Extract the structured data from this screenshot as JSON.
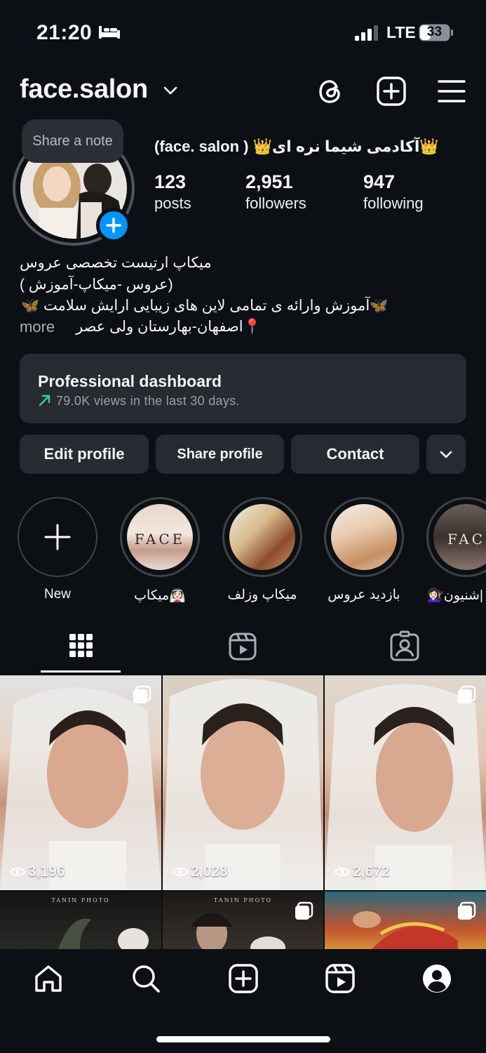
{
  "status_bar": {
    "time": "21:20",
    "network": "LTE",
    "battery": "33"
  },
  "header": {
    "username": "face.salon"
  },
  "profile": {
    "note_label": "Share a note",
    "display_name": "(face. salon ) 👑آکادمی شیما نره ای👑",
    "stats": [
      {
        "count": "123",
        "label": "posts"
      },
      {
        "count": "2,951",
        "label": "followers"
      },
      {
        "count": "947",
        "label": "following"
      }
    ],
    "bio_lines": [
      "میکاپ ارتیست تخصصی عروس",
      "(عروس -میکاپ-آموزش )",
      "🦋آموزش وارائه ی تمامی لاین های زیبایی ارایش سلامت 🦋",
      "📍اصفهان-بهارستان ولی عصر"
    ],
    "more_label": "more"
  },
  "dashboard": {
    "title": "Professional dashboard",
    "subtitle": "79.0K views in the last 30 days."
  },
  "buttons": {
    "edit": "Edit profile",
    "share": "Share profile",
    "contact": "Contact"
  },
  "highlights": [
    {
      "label": "New"
    },
    {
      "label": "میکاپ👰🏻",
      "cover_text": "FACE"
    },
    {
      "label": "میکاپ وزلف"
    },
    {
      "label": "بازدید عروس"
    },
    {
      "label": "💇🏻‍♀️شنیون|",
      "cover_text": "FAC"
    }
  ],
  "posts": [
    {
      "views": "3,196"
    },
    {
      "views": "2,028"
    },
    {
      "views": "2,672"
    },
    {
      "watermark": "TANIN PHOTO"
    },
    {
      "watermark": "TANIN PHOTO"
    },
    {
      "views": ""
    }
  ],
  "colors": {
    "background": "#0c1014",
    "surface": "#262a31",
    "accent": "#0095f6",
    "growth": "#3fce8c"
  }
}
